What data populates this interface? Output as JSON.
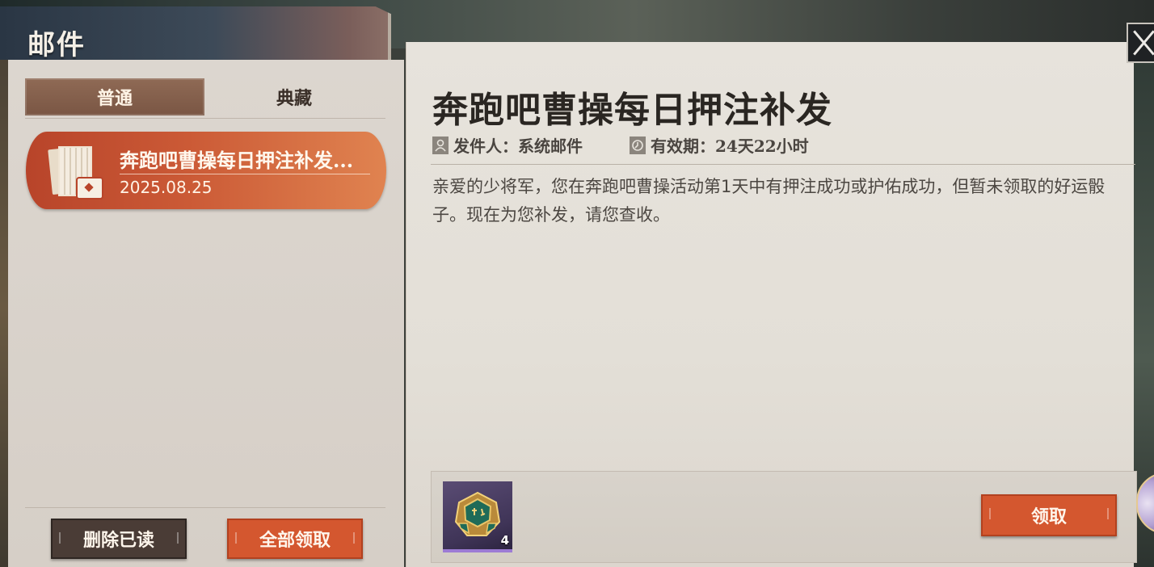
{
  "window": {
    "title": "邮件"
  },
  "tabs": [
    {
      "label": "普通",
      "active": true
    },
    {
      "label": "典藏",
      "active": false
    }
  ],
  "mail_list": [
    {
      "title": "奔跑吧曹操每日押注补发...",
      "date": "2025.08.25",
      "selected": true
    }
  ],
  "left_actions": {
    "delete_read": "删除已读",
    "claim_all": "全部领取"
  },
  "detail": {
    "title": "奔跑吧曹操每日押注补发",
    "sender": "发件人：系统邮件",
    "validity": "有效期：24天22小时",
    "body": "亲爱的少将军，您在奔跑吧曹操活动第1天中有押注成功或护佑成功，但暂未领取的好运骰子。现在为您补发，请您查收。",
    "reward": {
      "icon": "dice-icon",
      "count": "4"
    },
    "claim": "领取"
  },
  "colors": {
    "accent": "#d4572f",
    "selected_item": "#c8512f",
    "tab_active": "#835f4c",
    "panel": "#e5e1da"
  }
}
